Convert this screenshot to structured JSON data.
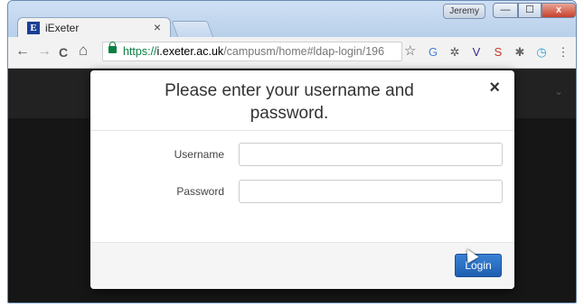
{
  "browser": {
    "tab": {
      "favicon_letter": "E",
      "title": "iExeter",
      "close_glyph": "×"
    },
    "user_badge": "Jeremy",
    "window_controls": {
      "minimize": "—",
      "maximize": "☐",
      "close": "x"
    },
    "nav": {
      "back": "←",
      "forward": "→",
      "reload": "C",
      "home": "⌂"
    },
    "address": {
      "scheme": "https://",
      "host": "i.exeter.ac.uk",
      "path": "/campusm/home#ldap-login/196"
    },
    "star_glyph": "☆",
    "extensions": [
      {
        "name": "translate-extension",
        "glyph": "G",
        "color": "#4a7fd8"
      },
      {
        "name": "puzzle-extension",
        "glyph": "✲",
        "color": "#555555"
      },
      {
        "name": "v-extension",
        "glyph": "V",
        "color": "#3b2a8f"
      },
      {
        "name": "s-extension",
        "glyph": "S",
        "color": "#c0392b"
      },
      {
        "name": "sparkle-extension",
        "glyph": "✱",
        "color": "#666666"
      },
      {
        "name": "timer-extension",
        "glyph": "◷",
        "color": "#2a9fd6"
      },
      {
        "name": "menu-extension",
        "glyph": "⋮",
        "color": "#555555"
      }
    ]
  },
  "modal": {
    "title": "Please enter your username and password.",
    "close_glyph": "×",
    "username": {
      "label": "Username",
      "value": "",
      "placeholder": ""
    },
    "password": {
      "label": "Password",
      "value": "",
      "placeholder": ""
    },
    "login_label": "Login"
  },
  "page": {
    "header_chevron": "⌄"
  }
}
